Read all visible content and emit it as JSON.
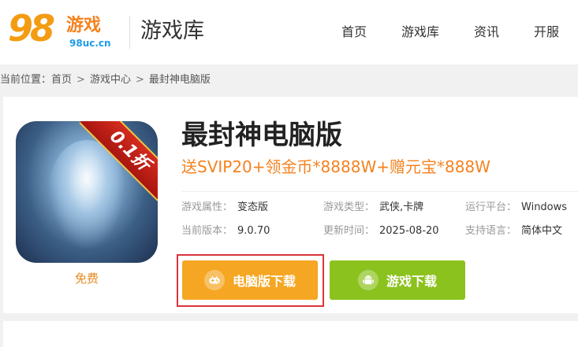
{
  "header": {
    "logo_text": "98",
    "logo_game": "游戏",
    "logo_domain": "98uc.cn",
    "section_title": "游戏库",
    "nav": [
      {
        "label": "首页"
      },
      {
        "label": "游戏库"
      },
      {
        "label": "资讯"
      },
      {
        "label": "开服"
      }
    ]
  },
  "breadcrumb": {
    "prefix": "当前位置：",
    "items": [
      "首页",
      "游戏中心",
      "最封神电脑版"
    ],
    "separator": ">"
  },
  "game": {
    "discount_badge": "0.1折",
    "price_label": "免费",
    "title": "最封神电脑版",
    "promo": "送SVIP20+领金币*8888W+赠元宝*888W",
    "attributes": [
      [
        {
          "key": "游戏属性：",
          "value": "变态版"
        },
        {
          "key": "游戏类型：",
          "value": "武侠,卡牌"
        },
        {
          "key": "运行平台：",
          "value": "Windows"
        }
      ],
      [
        {
          "key": "当前版本：",
          "value": "9.0.70"
        },
        {
          "key": "更新时间：",
          "value": "2025-08-20"
        },
        {
          "key": "支持语言：",
          "value": "简体中文"
        }
      ]
    ],
    "buttons": {
      "pc_download": "电脑版下载",
      "game_download": "游戏下载"
    }
  },
  "colors": {
    "accent_orange": "#f5821f",
    "btn_pc": "#f5a623",
    "btn_game": "#8cc21e",
    "highlight": "#d9343b"
  }
}
